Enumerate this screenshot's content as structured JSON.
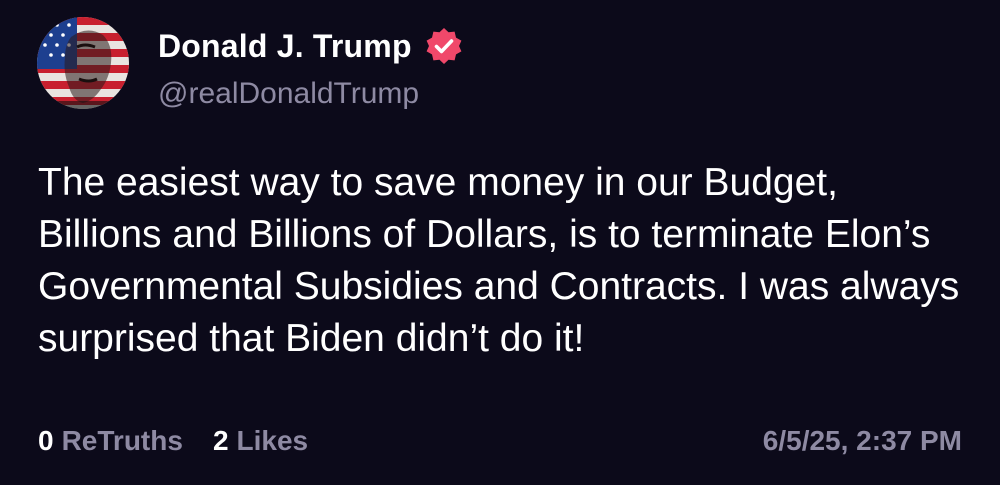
{
  "author": {
    "display_name": "Donald J. Trump",
    "handle": "@realDonaldTrump",
    "verified_icon": "verified-badge-icon",
    "avatar_icon": "avatar-flag-portrait"
  },
  "post": {
    "text": "The easiest way to save money in our Budget, Billions and Billions of Dollars, is to terminate Elon’s Governmental Subsidies and Contracts. I was always surprised that Biden didn’t do it!"
  },
  "stats": {
    "retruths_count": "0",
    "retruths_label": "ReTruths",
    "likes_count": "2",
    "likes_label": "Likes"
  },
  "timestamp": "6/5/25, 2:37 PM",
  "colors": {
    "background": "#0c0a1a",
    "text_primary": "#ffffff",
    "text_secondary": "#8e8aa3",
    "verified_badge": "#f0486a"
  }
}
